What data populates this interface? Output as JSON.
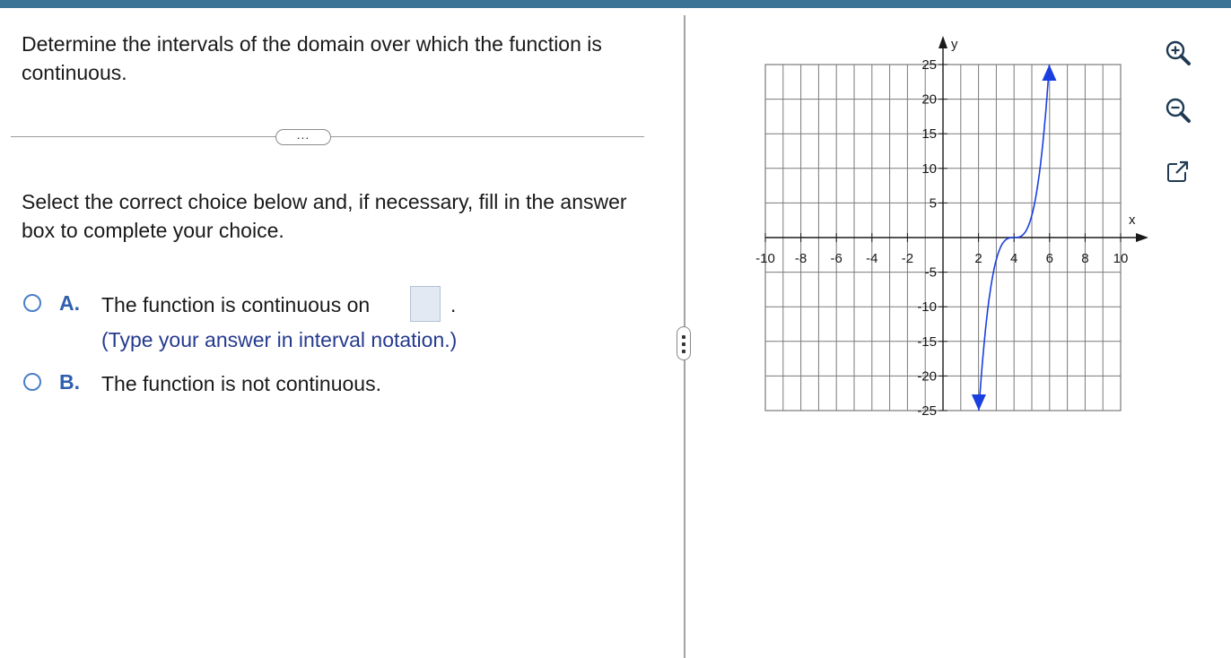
{
  "question": {
    "text": "Determine the intervals of the domain over which the function is continuous.",
    "more_label": "..."
  },
  "instruction": "Select the correct choice below and, if necessary, fill in the answer box to complete your choice.",
  "choices": [
    {
      "letter": "A.",
      "text": "The function is continuous on",
      "period": ".",
      "hint": "(Type your answer in interval notation.)",
      "answer_value": ""
    },
    {
      "letter": "B.",
      "text": "The function is not continuous."
    }
  ],
  "graph": {
    "x_axis_label": "x",
    "y_axis_label": "y",
    "x_ticks": [
      "-10",
      "-8",
      "-6",
      "-4",
      "-2",
      "2",
      "4",
      "6",
      "8",
      "10"
    ],
    "y_ticks_positive": [
      "25",
      "20",
      "15",
      "10",
      "5"
    ],
    "y_ticks_negative": [
      "-5",
      "-10",
      "-15",
      "-20",
      "-25"
    ],
    "x_range": [
      -10,
      10
    ],
    "y_range": [
      -25,
      25
    ],
    "curve_color": "#1a3fe0",
    "curve_description": "cubic curve with inflection at (4, 0)",
    "grid": true
  },
  "tools": [
    {
      "name": "zoom-in-icon"
    },
    {
      "name": "zoom-out-icon"
    },
    {
      "name": "popout-icon"
    }
  ],
  "colors": {
    "accent": "#3b7397",
    "choice_letter": "#2f5fae",
    "hint": "#243a8e"
  }
}
